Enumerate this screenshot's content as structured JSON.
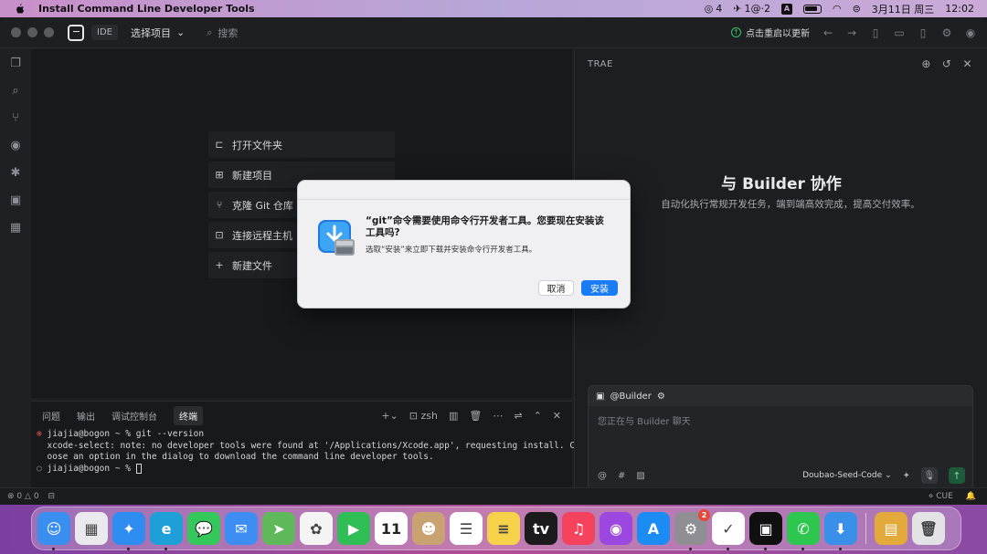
{
  "menubar": {
    "app_title": "Install Command Line Developer Tools",
    "wechat_count": "4",
    "vpn_label": "1@·2",
    "input_method": "A",
    "datetime": "3月11日 周三",
    "time": "12:02"
  },
  "titlebar": {
    "ide_tag": "IDE",
    "project_select": "选择项目",
    "search_placeholder": "搜索",
    "update_label": "点击重启以更新"
  },
  "welcome": {
    "items": [
      {
        "icon": "folder-open-icon",
        "label": "打开文件夹"
      },
      {
        "icon": "new-project-icon",
        "label": "新建项目"
      },
      {
        "icon": "git-branch-icon",
        "label": "克隆 Git 仓库"
      },
      {
        "icon": "remote-host-icon",
        "label": "连接远程主机"
      },
      {
        "icon": "plus-icon",
        "label": "新建文件"
      }
    ]
  },
  "panel": {
    "tabs": [
      "问题",
      "输出",
      "调试控制台",
      "终端"
    ],
    "active_tab": "终端",
    "shell": "zsh",
    "terminal_lines": [
      {
        "prefix": "⊗",
        "text": "jiajia@bogon ~ % git --version"
      },
      {
        "prefix": " ",
        "text": "xcode-select: note: no developer tools were found at '/Applications/Xcode.app', requesting install. Ch"
      },
      {
        "prefix": " ",
        "text": "oose an option in the dialog to download the command line developer tools."
      },
      {
        "prefix": "○",
        "text": "jiajia@bogon ~ % "
      }
    ]
  },
  "statusbar": {
    "errors": "0",
    "warnings": "0",
    "right_label": "CUE"
  },
  "side": {
    "header": "TRAE",
    "title": "与 Builder 协作",
    "subtitle": "自动化执行常规开发任务，端到端高效完成，提高交付效率。",
    "chat_agent": "@Builder",
    "chat_placeholder": "您正在与 Builder 聊天",
    "model": "Doubao-Seed-Code"
  },
  "dialog": {
    "title": "“git”命令需要使用命令行开发者工具。您要现在安装该工具吗?",
    "message": "选取“安装”来立即下载并安装命令行开发者工具。",
    "cancel_label": "取消",
    "install_label": "安装",
    "accent": "#1a7cf5"
  },
  "dock": {
    "apps": [
      {
        "name": "finder",
        "icon": "finder-icon",
        "color": "#3a8ef0",
        "glyph": "☺",
        "running": true
      },
      {
        "name": "launchpad",
        "icon": "launchpad-icon",
        "color": "#e9e9ee",
        "glyph": "▦",
        "running": false
      },
      {
        "name": "safari",
        "icon": "safari-icon",
        "color": "#2f8cf0",
        "glyph": "✦",
        "running": true
      },
      {
        "name": "edge",
        "icon": "edge-icon",
        "color": "#1f9fd8",
        "glyph": "e",
        "running": true
      },
      {
        "name": "messages",
        "icon": "messages-icon",
        "color": "#34c759",
        "glyph": "💬",
        "running": false
      },
      {
        "name": "mail",
        "icon": "mail-icon",
        "color": "#3d8df2",
        "glyph": "✉",
        "running": false
      },
      {
        "name": "maps",
        "icon": "maps-icon",
        "color": "#5fb85a",
        "glyph": "➤",
        "running": false
      },
      {
        "name": "photos",
        "icon": "photos-icon",
        "color": "#f4f4f4",
        "glyph": "✿",
        "running": false
      },
      {
        "name": "facetime",
        "icon": "facetime-icon",
        "color": "#2fbd55",
        "glyph": "▶",
        "running": false
      },
      {
        "name": "calendar",
        "icon": "calendar-icon",
        "color": "#ffffff",
        "glyph": "11",
        "running": false
      },
      {
        "name": "contacts",
        "icon": "contacts-icon",
        "color": "#c8a271",
        "glyph": "☻",
        "running": false
      },
      {
        "name": "reminders",
        "icon": "reminders-icon",
        "color": "#ffffff",
        "glyph": "☰",
        "running": false
      },
      {
        "name": "notes",
        "icon": "notes-icon",
        "color": "#f6d24a",
        "glyph": "≡",
        "running": false
      },
      {
        "name": "apple-tv",
        "icon": "apple-tv-icon",
        "color": "#1b1b1d",
        "glyph": "tv",
        "running": false
      },
      {
        "name": "music",
        "icon": "music-icon",
        "color": "#f5425d",
        "glyph": "♫",
        "running": false
      },
      {
        "name": "podcasts",
        "icon": "podcasts-icon",
        "color": "#9b47e0",
        "glyph": "◉",
        "running": false
      },
      {
        "name": "app-store",
        "icon": "app-store-icon",
        "color": "#1c8cf5",
        "glyph": "A",
        "running": false
      },
      {
        "name": "system-settings",
        "icon": "settings-icon",
        "color": "#8e8e93",
        "glyph": "⚙",
        "running": true,
        "badge": "2"
      },
      {
        "name": "lark",
        "icon": "lark-icon",
        "color": "#ffffff",
        "glyph": "✓",
        "running": true
      },
      {
        "name": "trae",
        "icon": "trae-icon",
        "color": "#101010",
        "glyph": "▣",
        "running": true
      },
      {
        "name": "wechat",
        "icon": "wechat-icon",
        "color": "#2dc74f",
        "glyph": "✆",
        "running": true
      },
      {
        "name": "installer",
        "icon": "installer-icon",
        "color": "#3a8fe8",
        "glyph": "⬇",
        "running": true
      }
    ],
    "trailing": [
      {
        "name": "archive",
        "icon": "package-icon",
        "color": "#e3a93a",
        "glyph": "▤"
      },
      {
        "name": "trash",
        "icon": "trash-icon",
        "color": "#e3e3e6",
        "glyph": "🗑"
      }
    ]
  }
}
